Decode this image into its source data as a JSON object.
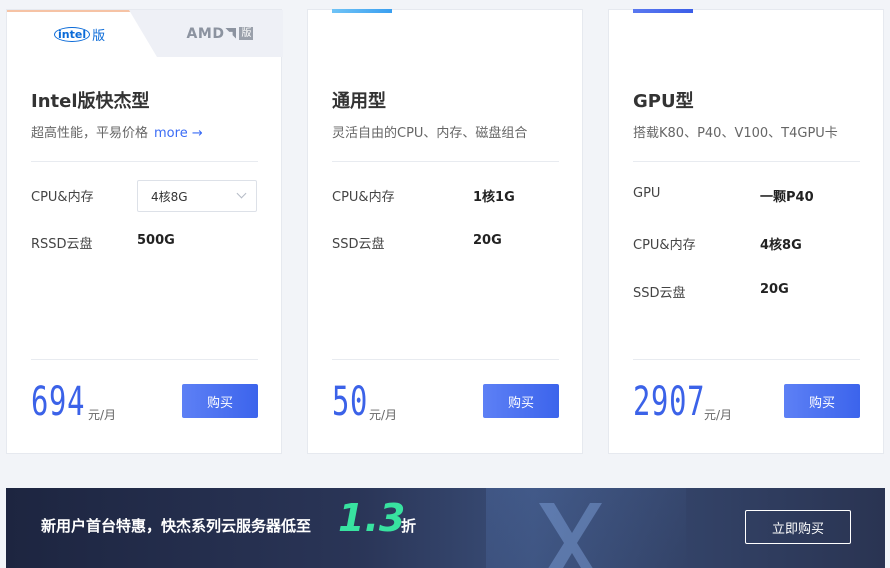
{
  "cards": {
    "intel": {
      "tab_intel": "intel",
      "tab_intel_suffix": "版",
      "tab_amd": "AMD",
      "tab_amd_suffix": "版",
      "title": "Intel版快杰型",
      "subtitle": "超高性能，平易价格",
      "more": "more →",
      "specs": [
        {
          "label": "CPU&内存",
          "value": "4核8G"
        },
        {
          "label": "RSSD云盘",
          "value": "500G"
        }
      ],
      "price": "694",
      "unit": "元/月",
      "buy": "购买"
    },
    "general": {
      "title": "通用型",
      "subtitle": "灵活自由的CPU、内存、磁盘组合",
      "specs": [
        {
          "label": "CPU&内存",
          "value": "1核1G"
        },
        {
          "label": "SSD云盘",
          "value": "20G"
        }
      ],
      "price": "50",
      "unit": "元/月",
      "buy": "购买"
    },
    "gpu": {
      "title": "GPU型",
      "subtitle": "搭载K80、P40、V100、T4GPU卡",
      "specs": [
        {
          "label": "GPU",
          "value": "一颗P40"
        },
        {
          "label": "CPU&内存",
          "value": "4核8G"
        },
        {
          "label": "SSD云盘",
          "value": "20G"
        }
      ],
      "price": "2907",
      "unit": "元/月",
      "buy": "购买"
    }
  },
  "banner": {
    "text": "新用户首台特惠，快杰系列云服务器低至",
    "discount": "1.3",
    "suffix": "折",
    "button": "立即购买"
  },
  "colors": {
    "accent": "#3b62e8",
    "button": "#4c70f0",
    "discount": "#38e2a0"
  }
}
